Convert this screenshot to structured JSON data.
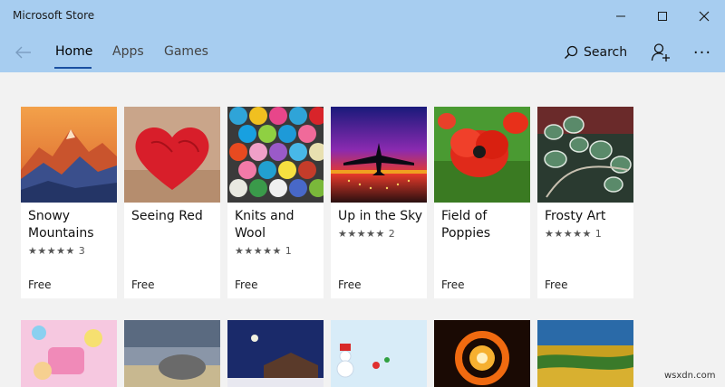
{
  "window": {
    "title": "Microsoft Store",
    "controls": [
      "minimize-icon",
      "maximize-icon",
      "close-icon"
    ]
  },
  "nav": {
    "tabs": [
      {
        "label": "Home",
        "active": true
      },
      {
        "label": "Apps",
        "active": false
      },
      {
        "label": "Games",
        "active": false
      }
    ],
    "search_label": "Search",
    "more_label": "···"
  },
  "cards": [
    {
      "title": "Snowy Mountains",
      "rating": "★★★★★ 3",
      "price": "Free"
    },
    {
      "title": "Seeing Red",
      "rating": "",
      "price": "Free"
    },
    {
      "title": "Knits and Wool",
      "rating": "★★★★★ 1",
      "price": "Free"
    },
    {
      "title": "Up in the Sky",
      "rating": "★★★★★ 2",
      "price": "Free"
    },
    {
      "title": "Field of Poppies",
      "rating": "",
      "price": "Free"
    },
    {
      "title": "Frosty Art",
      "rating": "★★★★★ 1",
      "price": "Free"
    }
  ],
  "watermark": "wsxdn.com",
  "colors": {
    "titlebar": "#a7cdf0",
    "accent": "#1a4fa0",
    "background": "#f2f2f2"
  }
}
